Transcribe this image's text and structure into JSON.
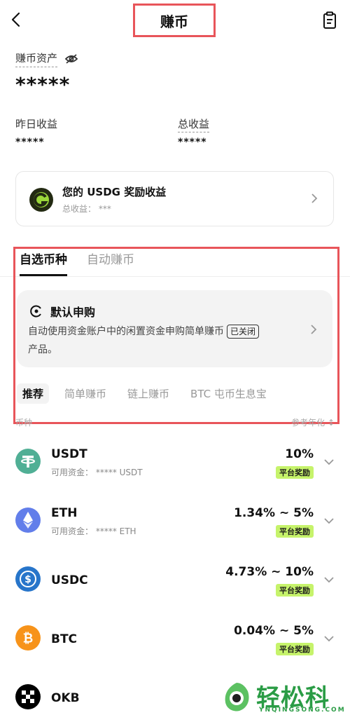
{
  "header": {
    "title": "赚币"
  },
  "assets": {
    "label": "赚币资产",
    "value": "*****"
  },
  "earnings": {
    "yesterday_label": "昨日收益",
    "yesterday_value": "*****",
    "total_label": "总收益",
    "total_value": "*****"
  },
  "reward_card": {
    "title": "您的 USDG 奖励收益",
    "subtitle": "总收益： ***"
  },
  "tabs": [
    {
      "label": "自选币种"
    },
    {
      "label": "自动赚币"
    }
  ],
  "auto_subscribe": {
    "title": "默认申购",
    "description_1": "自动使用资金账户中的闲置资金申购简单赚币",
    "badge": "已关闭",
    "description_2": "产品。"
  },
  "filters": [
    {
      "label": "推荐"
    },
    {
      "label": "简单赚币"
    },
    {
      "label": "链上赚币"
    },
    {
      "label": "BTC 屯币生息宝"
    }
  ],
  "list_header": {
    "left": "币种",
    "right": "参考年化 ↕"
  },
  "coins": [
    {
      "name": "USDT",
      "sub": "可用资金： ***** USDT",
      "rate": "10%",
      "badge": "平台奖励",
      "icon": "usdt-icon",
      "color": "#50af95"
    },
    {
      "name": "ETH",
      "sub": "可用资金： ***** ETH",
      "rate": "1.34% ~ 5%",
      "badge": "平台奖励",
      "icon": "eth-icon",
      "color": "#627eea"
    },
    {
      "name": "USDC",
      "sub": "",
      "rate": "4.73% ~ 10%",
      "badge": "平台奖励",
      "icon": "usdc-icon",
      "color": "#2775ca"
    },
    {
      "name": "BTC",
      "sub": "",
      "rate": "0.04% ~ 5%",
      "badge": "平台奖励",
      "icon": "btc-icon",
      "color": "#f7931a"
    },
    {
      "name": "OKB",
      "sub": "",
      "rate": "",
      "badge": "",
      "icon": "okb-icon",
      "color": "#000000"
    }
  ],
  "watermark": {
    "text": "轻松科技",
    "sub": "YNQINGSONG.COM"
  },
  "colors": {
    "highlight": "#e8555a",
    "badge_green": "#c6f36b",
    "watermark_green": "#2a9c45"
  }
}
